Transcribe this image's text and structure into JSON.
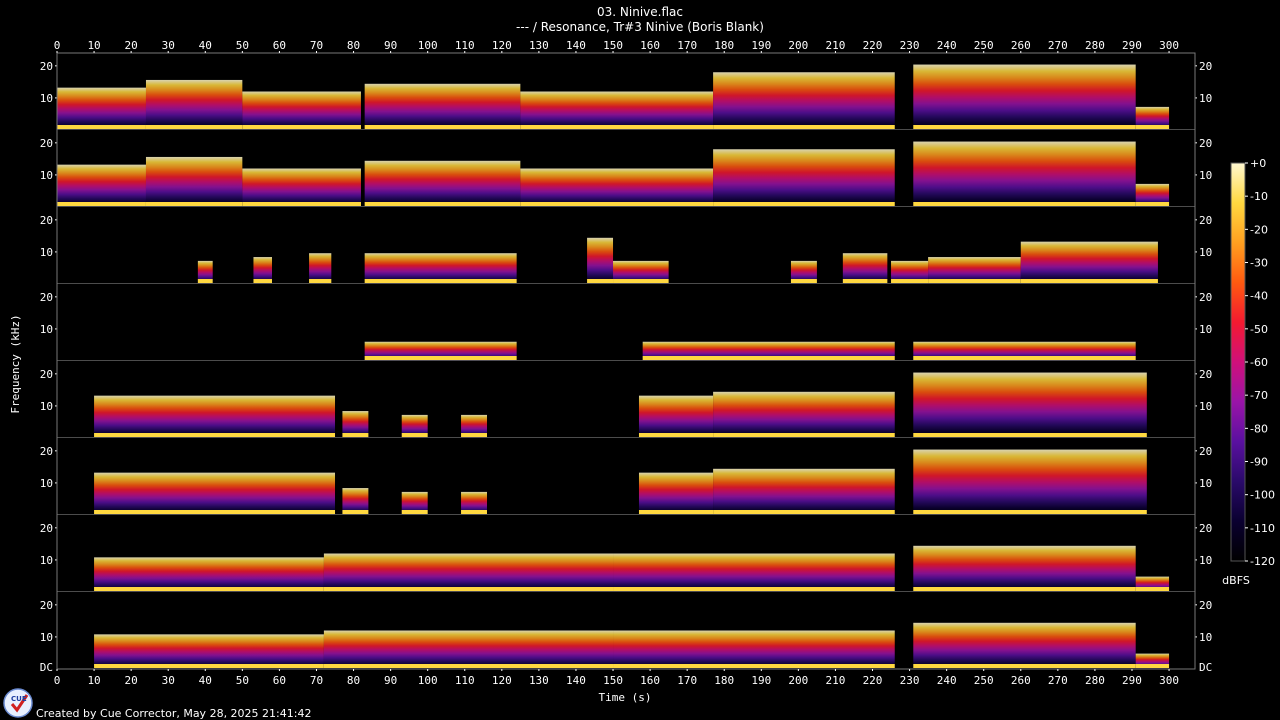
{
  "header": {
    "title": "03. Ninive.flac",
    "subtitle": "--- / Resonance, Tr#3 Ninive (Boris Blank)"
  },
  "footer": {
    "text": "Created by Cue Corrector, May 28, 2025 21:41:42"
  },
  "logo": {
    "icon": "cue-corrector-logo-icon",
    "text": "CUE"
  },
  "chart_data": {
    "type": "heatmap",
    "subtype": "spectrogram",
    "channels": 8,
    "xlabel": "Time (s)",
    "ylabel": "Frequency (kHz)",
    "xlim": [
      0,
      307
    ],
    "ylim": [
      0,
      24
    ],
    "x_ticks": [
      0,
      10,
      20,
      30,
      40,
      50,
      60,
      70,
      80,
      90,
      100,
      110,
      120,
      130,
      140,
      150,
      160,
      170,
      180,
      190,
      200,
      210,
      220,
      230,
      240,
      250,
      260,
      270,
      280,
      290,
      300
    ],
    "y_ticks": [
      {
        "value": 20,
        "label": "20"
      },
      {
        "value": 10,
        "label": "10"
      }
    ],
    "bottom_y_tick": {
      "value": 0,
      "label": "DC"
    },
    "colorbar": {
      "label": "dBFS",
      "range": [
        -120,
        0
      ],
      "ticks": [
        {
          "value": 0,
          "label": "+0"
        },
        {
          "value": -10,
          "label": "-10"
        },
        {
          "value": -20,
          "label": "-20"
        },
        {
          "value": -30,
          "label": "-30"
        },
        {
          "value": -40,
          "label": "-40"
        },
        {
          "value": -50,
          "label": "-50"
        },
        {
          "value": -60,
          "label": "-60"
        },
        {
          "value": -70,
          "label": "-70"
        },
        {
          "value": -80,
          "label": "-80"
        },
        {
          "value": -90,
          "label": "-90"
        },
        {
          "value": -100,
          "label": "-100"
        },
        {
          "value": -110,
          "label": "-110"
        },
        {
          "value": -120,
          "label": "-120"
        }
      ],
      "colors": [
        "#000000",
        "#0a0030",
        "#2a0a6a",
        "#5a10a0",
        "#9a14a8",
        "#d0107a",
        "#f41a30",
        "#ff5a10",
        "#ffa020",
        "#ffd840",
        "#fff8d0"
      ]
    },
    "channel_activity": [
      {
        "segments": [
          [
            0,
            24,
            0.55
          ],
          [
            24,
            50,
            0.65
          ],
          [
            50,
            82,
            0.5
          ],
          [
            83,
            125,
            0.6
          ],
          [
            125,
            177,
            0.5
          ],
          [
            177,
            226,
            0.75
          ],
          [
            231,
            291,
            0.85
          ],
          [
            291,
            300,
            0.3
          ]
        ]
      },
      {
        "segments": [
          [
            0,
            24,
            0.55
          ],
          [
            24,
            50,
            0.65
          ],
          [
            50,
            82,
            0.5
          ],
          [
            83,
            125,
            0.6
          ],
          [
            125,
            177,
            0.5
          ],
          [
            177,
            226,
            0.75
          ],
          [
            231,
            291,
            0.85
          ],
          [
            291,
            300,
            0.3
          ]
        ]
      },
      {
        "segments": [
          [
            38,
            42,
            0.3
          ],
          [
            53,
            58,
            0.35
          ],
          [
            68,
            74,
            0.4
          ],
          [
            83,
            124,
            0.4
          ],
          [
            143,
            150,
            0.6
          ],
          [
            150,
            165,
            0.3
          ],
          [
            198,
            205,
            0.3
          ],
          [
            212,
            224,
            0.4
          ],
          [
            225,
            235,
            0.3
          ],
          [
            235,
            260,
            0.35
          ],
          [
            260,
            297,
            0.55
          ]
        ]
      },
      {
        "segments": [
          [
            83,
            124,
            0.25
          ],
          [
            158,
            226,
            0.25
          ],
          [
            231,
            291,
            0.25
          ]
        ]
      },
      {
        "segments": [
          [
            10,
            75,
            0.55
          ],
          [
            77,
            84,
            0.35
          ],
          [
            93,
            100,
            0.3
          ],
          [
            109,
            116,
            0.3
          ],
          [
            157,
            177,
            0.55
          ],
          [
            177,
            226,
            0.6
          ],
          [
            231,
            294,
            0.85
          ]
        ]
      },
      {
        "segments": [
          [
            10,
            75,
            0.55
          ],
          [
            77,
            84,
            0.35
          ],
          [
            93,
            100,
            0.3
          ],
          [
            109,
            116,
            0.3
          ],
          [
            157,
            177,
            0.55
          ],
          [
            177,
            226,
            0.6
          ],
          [
            231,
            294,
            0.85
          ]
        ]
      },
      {
        "segments": [
          [
            10,
            72,
            0.45
          ],
          [
            72,
            150,
            0.5
          ],
          [
            150,
            226,
            0.5
          ],
          [
            231,
            291,
            0.6
          ],
          [
            291,
            300,
            0.2
          ]
        ]
      },
      {
        "segments": [
          [
            10,
            72,
            0.45
          ],
          [
            72,
            150,
            0.5
          ],
          [
            150,
            226,
            0.5
          ],
          [
            231,
            291,
            0.6
          ],
          [
            291,
            300,
            0.2
          ]
        ]
      }
    ]
  }
}
